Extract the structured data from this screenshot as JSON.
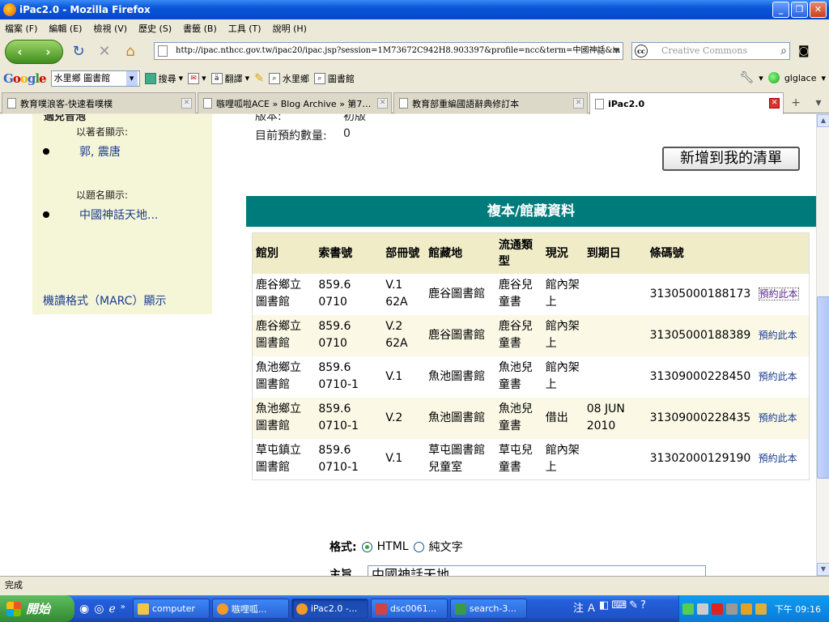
{
  "window": {
    "title": "iPac2.0 - Mozilla Firefox",
    "min": "_",
    "max": "❐",
    "close": "✕"
  },
  "menu": [
    "檔案 (F)",
    "編輯 (E)",
    "檢視 (V)",
    "歷史 (S)",
    "書籤 (B)",
    "工具 (T)",
    "說明 (H)"
  ],
  "nav": {
    "url": "http://ipac.nthcc.gov.tw/ipac20/ipac.jsp?session=1M73672C942H8.903397&profile=ncc&term=中國神話&in",
    "search_placeholder": "Creative Commons",
    "search_engine": "cc"
  },
  "google_bar": {
    "logo": [
      "G",
      "o",
      "o",
      "g",
      "l",
      "e"
    ],
    "select": "水里鄉 圖書館",
    "search": "搜尋",
    "translate": "翻譯",
    "bookmark1": "水里鄉",
    "bookmark2": "圖書館",
    "user": "glglace"
  },
  "tabs": [
    {
      "label": "教育噗浪客-快速看噗樸",
      "active": false
    },
    {
      "label": "嗾哩呱啦ACE » Blog Archive » 第7…",
      "active": false
    },
    {
      "label": "教育部重編國語辭典修訂本",
      "active": false
    },
    {
      "label": "iPac2.0",
      "active": true
    }
  ],
  "sidebar": {
    "cut_heading": "適兒音泡",
    "author_label": "以著者顯示:",
    "author_link": "郭, 震唐",
    "title_label": "以題名顯示:",
    "title_link": "中國神話天地...",
    "marc_link": "機讀格式（MARC）顯示"
  },
  "info": {
    "cut_line_label": "版本:",
    "cut_line_value": "初版",
    "reserve_label": "目前預約數量:",
    "reserve_value": "0",
    "add_button": "新增到我的清單"
  },
  "holdings": {
    "header": "複本/館藏資料",
    "columns": [
      "館別",
      "索書號",
      "部冊號",
      "館藏地",
      "流通類型",
      "現況",
      "到期日",
      "條碼號",
      ""
    ],
    "rows": [
      {
        "library": "鹿谷鄉立圖書館",
        "callno": "859.6 0710",
        "vol": "V.1 62A",
        "location": "鹿谷圖書館",
        "type": "鹿谷兒童書",
        "status": "館內架上",
        "due": "",
        "barcode": "31305000188173",
        "action": "預約此本"
      },
      {
        "library": "鹿谷鄉立圖書館",
        "callno": "859.6 0710",
        "vol": "V.2 62A",
        "location": "鹿谷圖書館",
        "type": "鹿谷兒童書",
        "status": "館內架上",
        "due": "",
        "barcode": "31305000188389",
        "action": "預約此本"
      },
      {
        "library": "魚池鄉立圖書館",
        "callno": "859.6 0710-1",
        "vol": "V.1",
        "location": "魚池圖書館",
        "type": "魚池兒童書",
        "status": "館內架上",
        "due": "",
        "barcode": "31309000228450",
        "action": "預約此本"
      },
      {
        "library": "魚池鄉立圖書館",
        "callno": "859.6 0710-1",
        "vol": "V.2",
        "location": "魚池圖書館",
        "type": "魚池兒童書",
        "status": "借出",
        "due": "08 JUN 2010",
        "barcode": "31309000228435",
        "action": "預約此本"
      },
      {
        "library": "草屯鎮立圖書館",
        "callno": "859.6 0710-1",
        "vol": "V.1",
        "location": "草屯圖書館兒童室",
        "type": "草屯兒童書",
        "status": "館內架上",
        "due": "",
        "barcode": "31302000129190",
        "action": "預約此本"
      }
    ]
  },
  "format": {
    "label": "格式:",
    "opt1": "HTML",
    "opt2": "純文字",
    "selected": "HTML"
  },
  "subject": {
    "label": "主旨",
    "value": "中國神話天地"
  },
  "status": "完成",
  "taskbar": {
    "start": "開始",
    "tasks": [
      "computer",
      "嗾哩呱...",
      "iPac2.0 -...",
      "dsc0061...",
      "search-3..."
    ],
    "active_task": 2,
    "ime": "注",
    "clock": "下午 09:16"
  },
  "colors": {
    "header_teal": "#007b7b",
    "link_blue": "#1a3d8f",
    "sidebar_bg": "#f5f5d8",
    "table_head_bg": "#f0ecc8"
  }
}
